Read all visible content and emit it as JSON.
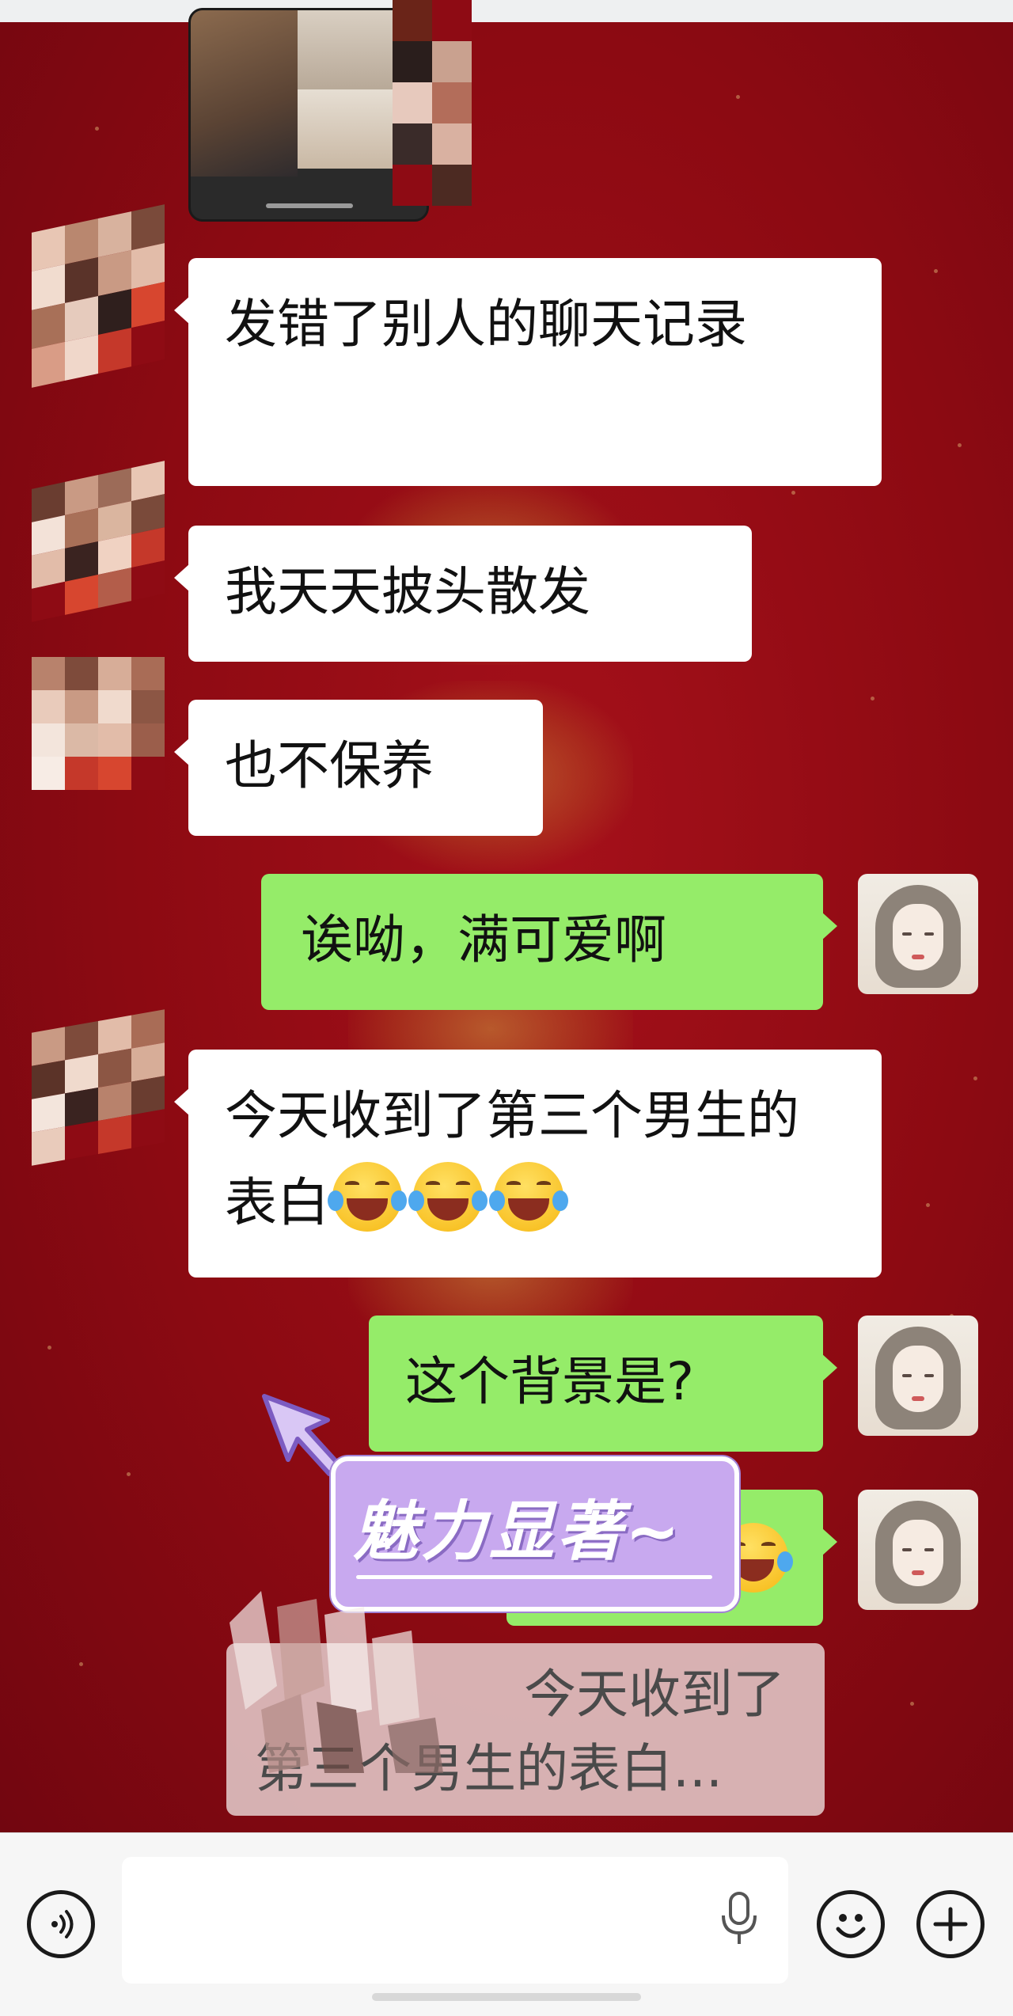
{
  "chat": {
    "messages": [
      {
        "side": "left",
        "text": "发错了别人的聊天记录"
      },
      {
        "side": "left",
        "text": "我天天披头散发"
      },
      {
        "side": "left",
        "text": "也不保养"
      },
      {
        "side": "right",
        "text": "诶呦，满可爱啊"
      },
      {
        "side": "left",
        "text": "今天收到了第三个男生的表白",
        "emoji_count": 3
      },
      {
        "side": "right",
        "text": "这个背景是?"
      }
    ]
  },
  "overlay": {
    "badge_text": "魅力显著~",
    "quote_line1": "今天收到了",
    "quote_line2": "第三个男生的表白..."
  },
  "input_bar": {
    "voice_icon": "voice-icon",
    "mic_icon": "microphone-icon",
    "emoji_icon": "emoji-icon",
    "plus_icon": "plus-icon"
  },
  "colors": {
    "background_red": "#8c0a12",
    "bubble_green": "#95ec69",
    "bubble_white": "#ffffff",
    "badge_purple": "#c8a9ef"
  }
}
